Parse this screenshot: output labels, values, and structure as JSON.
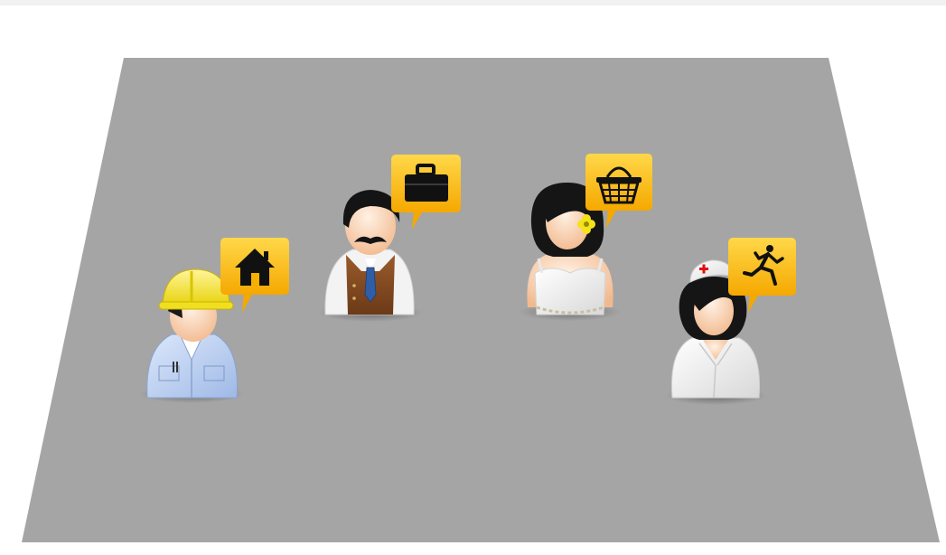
{
  "scene": {
    "floor_color": "#a5a5a5",
    "background_color": "#ffffff",
    "bubble_color": "#f7b500",
    "bubble_gradient_top": "#ffd23f",
    "figures": [
      {
        "role": "construction-worker",
        "bubble_icon": "house-icon"
      },
      {
        "role": "businessman",
        "bubble_icon": "briefcase-icon"
      },
      {
        "role": "bride",
        "bubble_icon": "shopping-basket-icon"
      },
      {
        "role": "nurse",
        "bubble_icon": "running-person-icon"
      }
    ]
  }
}
